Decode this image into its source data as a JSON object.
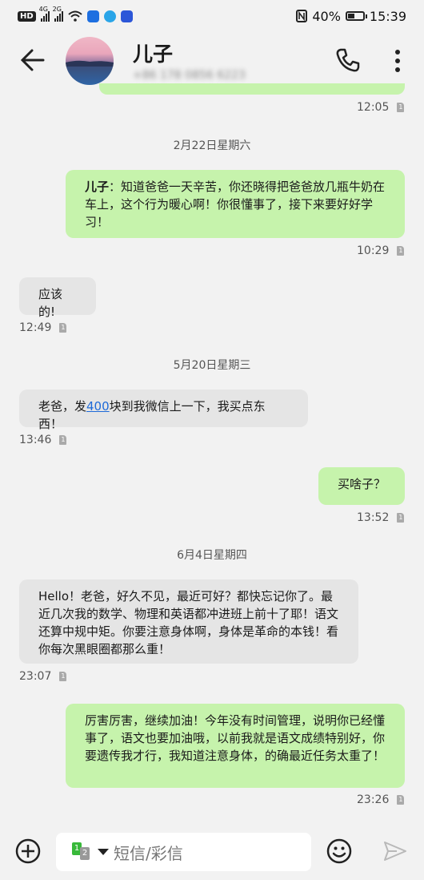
{
  "status_bar": {
    "left_badges": [
      "HD",
      "4G",
      "2G"
    ],
    "battery_text": "40%",
    "battery_level": 0.4,
    "time": "15:39"
  },
  "header": {
    "contact_name": "儿子",
    "contact_number": "+86 178 0856 6223",
    "icons": [
      "back-arrow-icon",
      "phone-icon",
      "more-vert-icon"
    ]
  },
  "messages": [
    {
      "type": "timestamp_out",
      "time": "12:05",
      "sim": "1"
    },
    {
      "type": "date",
      "text": "2月22日星期六"
    },
    {
      "type": "out",
      "sender": "儿子",
      "text": "：知道爸爸一天辛苦，你还晓得把爸爸放几瓶牛奶在车上，这个行为暖心啊！你很懂事了，接下来要好好学习！",
      "time": "10:29",
      "sim": "1"
    },
    {
      "type": "in",
      "text": "应该的!",
      "time": "12:49",
      "sim": "1"
    },
    {
      "type": "date",
      "text": "5月20日星期三"
    },
    {
      "type": "in",
      "text_before": "老爸，发",
      "link": "400",
      "text_after": "块到我微信上一下，我买点东西！",
      "time": "13:46",
      "sim": "1"
    },
    {
      "type": "out",
      "text": "买啥子？",
      "time": "13:52",
      "sim": "1"
    },
    {
      "type": "date",
      "text": "6月4日星期四"
    },
    {
      "type": "in",
      "text": "Hello！老爸，好久不见，最近可好？都快忘记你了。最近几次我的数学、物理和英语都冲进班上前十了耶！语文还算中规中矩。你要注意身体啊，身体是革命的本钱！看你每次黑眼圈都那么重！",
      "time": "23:07",
      "sim": "1"
    },
    {
      "type": "out",
      "text": "厉害厉害，继续加油！今年没有时间管理，说明你已经懂事了，语文也要加油哦，以前我就是语文成绩特别好，你要遗传我才行，我知道注意身体，的确最近任务太重了！",
      "time": "23:26",
      "sim": "1"
    }
  ],
  "composer": {
    "sim_primary": "1",
    "sim_secondary": "2",
    "placeholder": "短信/彩信",
    "icons": [
      "add-icon",
      "emoji-icon",
      "send-icon"
    ]
  },
  "colors": {
    "outgoing_bubble": "#c6f3ac",
    "incoming_bubble": "#e5e5e5",
    "background": "#f2f2f2",
    "link": "#1e6ad8"
  }
}
